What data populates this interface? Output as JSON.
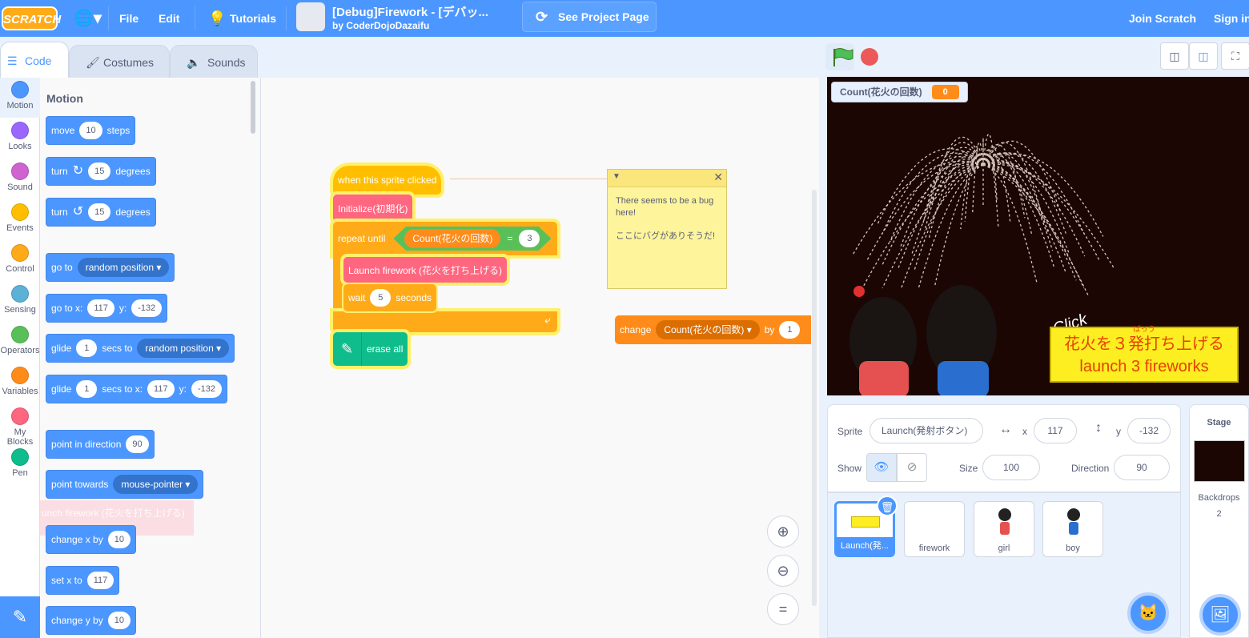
{
  "menu": {
    "logo": "SCRATCH",
    "file": "File",
    "edit": "Edit",
    "tutorials": "Tutorials",
    "project_title": "[Debug]Firework - [デバッ...",
    "project_author": "by CoderDojoDazaifu",
    "see_project_page": "See Project Page",
    "join": "Join Scratch",
    "signin": "Sign in"
  },
  "tabs": {
    "code": "Code",
    "costumes": "Costumes",
    "sounds": "Sounds"
  },
  "categories": [
    {
      "label": "Motion",
      "color": "#4c97ff"
    },
    {
      "label": "Looks",
      "color": "#9966ff"
    },
    {
      "label": "Sound",
      "color": "#cf63cf"
    },
    {
      "label": "Events",
      "color": "#ffbf00"
    },
    {
      "label": "Control",
      "color": "#ffab19"
    },
    {
      "label": "Sensing",
      "color": "#5cb1d6"
    },
    {
      "label": "Operators",
      "color": "#59c059"
    },
    {
      "label": "Variables",
      "color": "#ff8c1a"
    },
    {
      "label": "My Blocks",
      "color": "#ff6680"
    },
    {
      "label": "Pen",
      "color": "#0fbd8c"
    }
  ],
  "palette": {
    "heading": "Motion",
    "move": {
      "a": "move",
      "v": "10",
      "b": "steps"
    },
    "turn_right": {
      "a": "turn",
      "v": "15",
      "b": "degrees"
    },
    "turn_left": {
      "a": "turn",
      "v": "15",
      "b": "degrees"
    },
    "goto_random": {
      "a": "go to",
      "d": "random position"
    },
    "goto_xy": {
      "a": "go to x:",
      "x": "117",
      "b": "y:",
      "y": "-132"
    },
    "glide_random": {
      "a": "glide",
      "v": "1",
      "b": "secs to",
      "d": "random position"
    },
    "glide_xy": {
      "a": "glide",
      "v": "1",
      "b": "secs to x:",
      "x": "117",
      "c": "y:",
      "y": "-132"
    },
    "point_dir": {
      "a": "point in direction",
      "v": "90"
    },
    "point_towards": {
      "a": "point towards",
      "d": "mouse-pointer"
    },
    "drag_ghost": "unch firework (花火を打ち上げる)",
    "change_x": {
      "a": "change x by",
      "v": "10"
    },
    "set_x": {
      "a": "set x to",
      "v": "117"
    },
    "change_y": {
      "a": "change y by",
      "v": "10"
    }
  },
  "script": {
    "hat": "when this sprite clicked",
    "init": "Initialize(初期化)",
    "repeat": "repeat until",
    "count_var": "Count(花火の回数)",
    "equals": "=",
    "count_target": "3",
    "launch": "Launch firework (花火を打ち上げる)",
    "wait_a": "wait",
    "wait_v": "5",
    "wait_b": "seconds",
    "erase": "erase all",
    "change_a": "change",
    "change_var": "Count(花火の回数)",
    "change_b": "by",
    "change_v": "1"
  },
  "comment": {
    "line1": "There seems to be a bug here!",
    "line2": "ここにバグがありそうだ!"
  },
  "stage": {
    "monitor_label": "Count(花火の回数)",
    "monitor_value": "0",
    "click_text": "Click",
    "ruby": "ぱっう",
    "banner_jp": "花火を３発打ち上げる",
    "banner_en": "launch 3 fireworks"
  },
  "sprite_info": {
    "sprite_label": "Sprite",
    "sprite_name": "Launch(発射ボタン)",
    "x_label": "x",
    "x": "117",
    "y_label": "y",
    "y": "-132",
    "show_label": "Show",
    "size_label": "Size",
    "size": "100",
    "direction_label": "Direction",
    "direction": "90"
  },
  "sprites": [
    {
      "name": "Launch(発..."
    },
    {
      "name": "firework"
    },
    {
      "name": "girl"
    },
    {
      "name": "boy"
    }
  ],
  "stage_panel": {
    "title": "Stage",
    "backdrops_label": "Backdrops",
    "backdrops_count": "2"
  },
  "icons": {
    "globe": "globe-icon",
    "tutorials": "lightbulb-icon",
    "remix": "remix-icon",
    "flag": "green-flag-icon",
    "stop": "stop-icon",
    "pen": "pen-icon",
    "zoom_in": "zoom-in-icon",
    "zoom_out": "zoom-out-icon",
    "zoom_reset": "zoom-reset-icon"
  }
}
